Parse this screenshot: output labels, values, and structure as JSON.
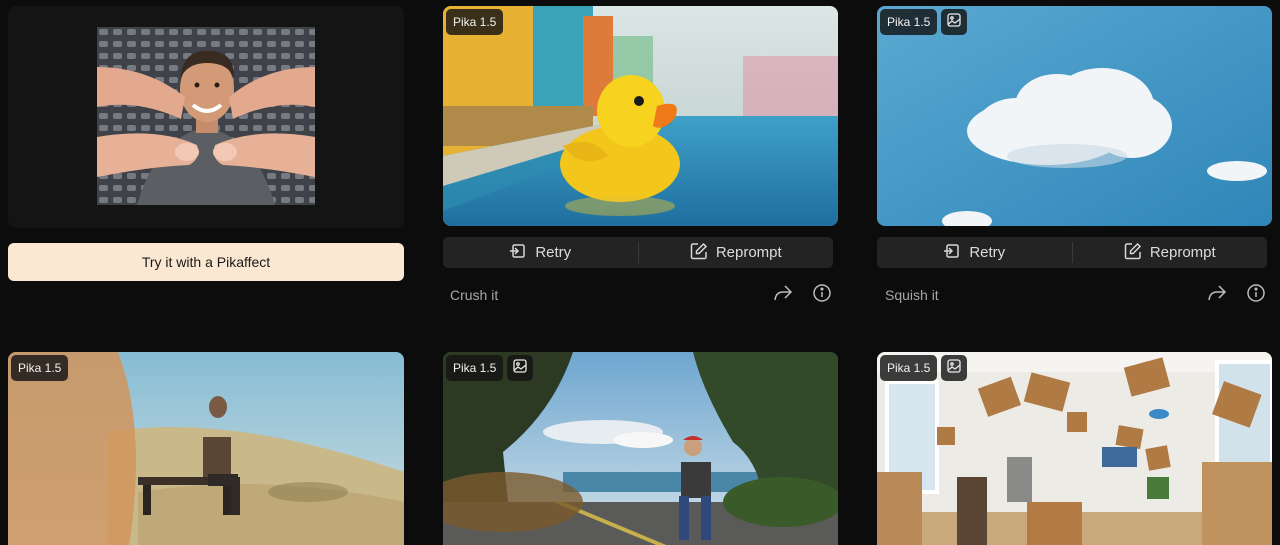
{
  "promo": {
    "button_label": "Try it with a Pikaffect"
  },
  "cards": [
    {
      "badge": "Pika 1.5",
      "caption": "Crush it",
      "retry": "Retry",
      "reprompt": "Reprompt"
    },
    {
      "badge": "Pika 1.5",
      "caption": "Squish it",
      "retry": "Retry",
      "reprompt": "Reprompt"
    },
    {
      "badge": "Pika 1.5"
    },
    {
      "badge": "Pika 1.5"
    },
    {
      "badge": "Pika 1.5"
    }
  ],
  "icons": {
    "image_badge": "image-icon",
    "retry": "retry-icon",
    "reprompt": "edit-icon",
    "share": "share-icon",
    "info": "info-icon"
  }
}
